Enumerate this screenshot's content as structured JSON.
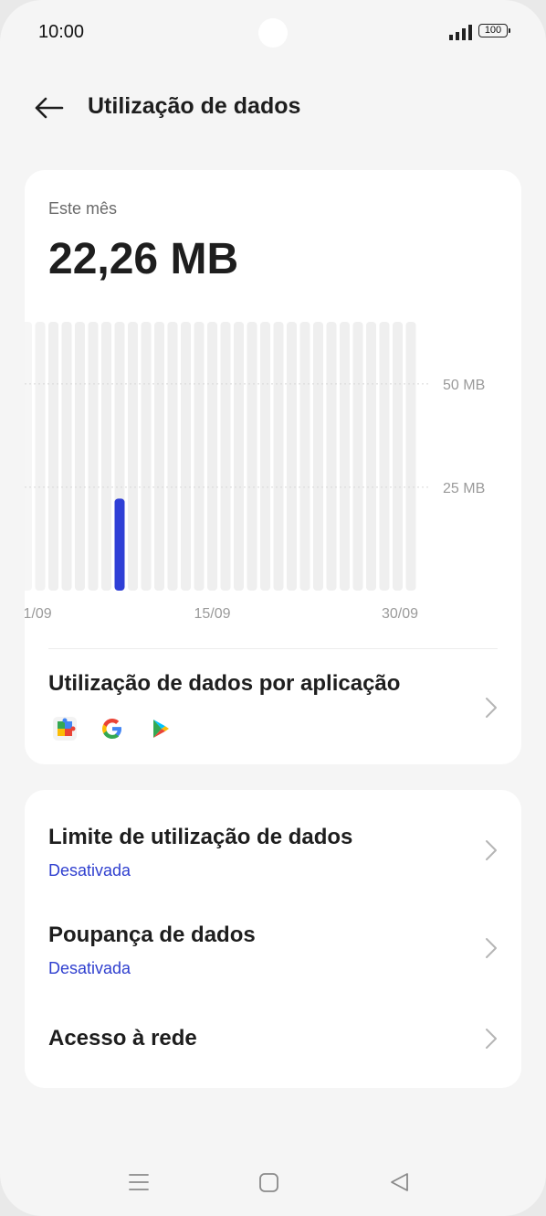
{
  "status_bar": {
    "time": "10:00",
    "battery": "100"
  },
  "header": {
    "title": "Utilização de dados",
    "back_icon": "arrow-left-icon"
  },
  "usage": {
    "period_label": "Este mês",
    "total": "22,26 MB",
    "accent_color": "#2f3fd6"
  },
  "chart_data": {
    "type": "bar",
    "x": [
      1,
      2,
      3,
      4,
      5,
      6,
      7,
      8,
      9,
      10,
      11,
      12,
      13,
      14,
      15,
      16,
      17,
      18,
      19,
      20,
      21,
      22,
      23,
      24,
      25,
      26,
      27,
      28,
      29,
      30
    ],
    "values": [
      0,
      0,
      0,
      0,
      0,
      0,
      0,
      22.26,
      0,
      0,
      0,
      0,
      0,
      0,
      0,
      0,
      0,
      0,
      0,
      0,
      0,
      0,
      0,
      0,
      0,
      0,
      0,
      0,
      0,
      0
    ],
    "xtick_labels": [
      {
        "day": 1,
        "label": "1/09"
      },
      {
        "day": 15,
        "label": "15/09"
      },
      {
        "day": 30,
        "label": "30/09"
      }
    ],
    "ytick_labels": [
      {
        "value": 50,
        "label": "50 MB"
      },
      {
        "value": 25,
        "label": "25 MB"
      }
    ],
    "ylim": [
      0,
      65
    ],
    "unit": "MB",
    "grid": true
  },
  "app_usage": {
    "title": "Utilização de dados por aplicação",
    "icons": [
      "puzzle-app-icon",
      "google-icon",
      "play-store-icon"
    ]
  },
  "settings": [
    {
      "title": "Limite de utilização de dados",
      "subtitle": "Desativada"
    },
    {
      "title": "Poupança de dados",
      "subtitle": "Desativada"
    },
    {
      "title": "Acesso à rede"
    }
  ],
  "nav_bar": {
    "menu_icon": "menu-icon",
    "home_icon": "home-square-icon",
    "back_icon": "back-triangle-icon"
  }
}
